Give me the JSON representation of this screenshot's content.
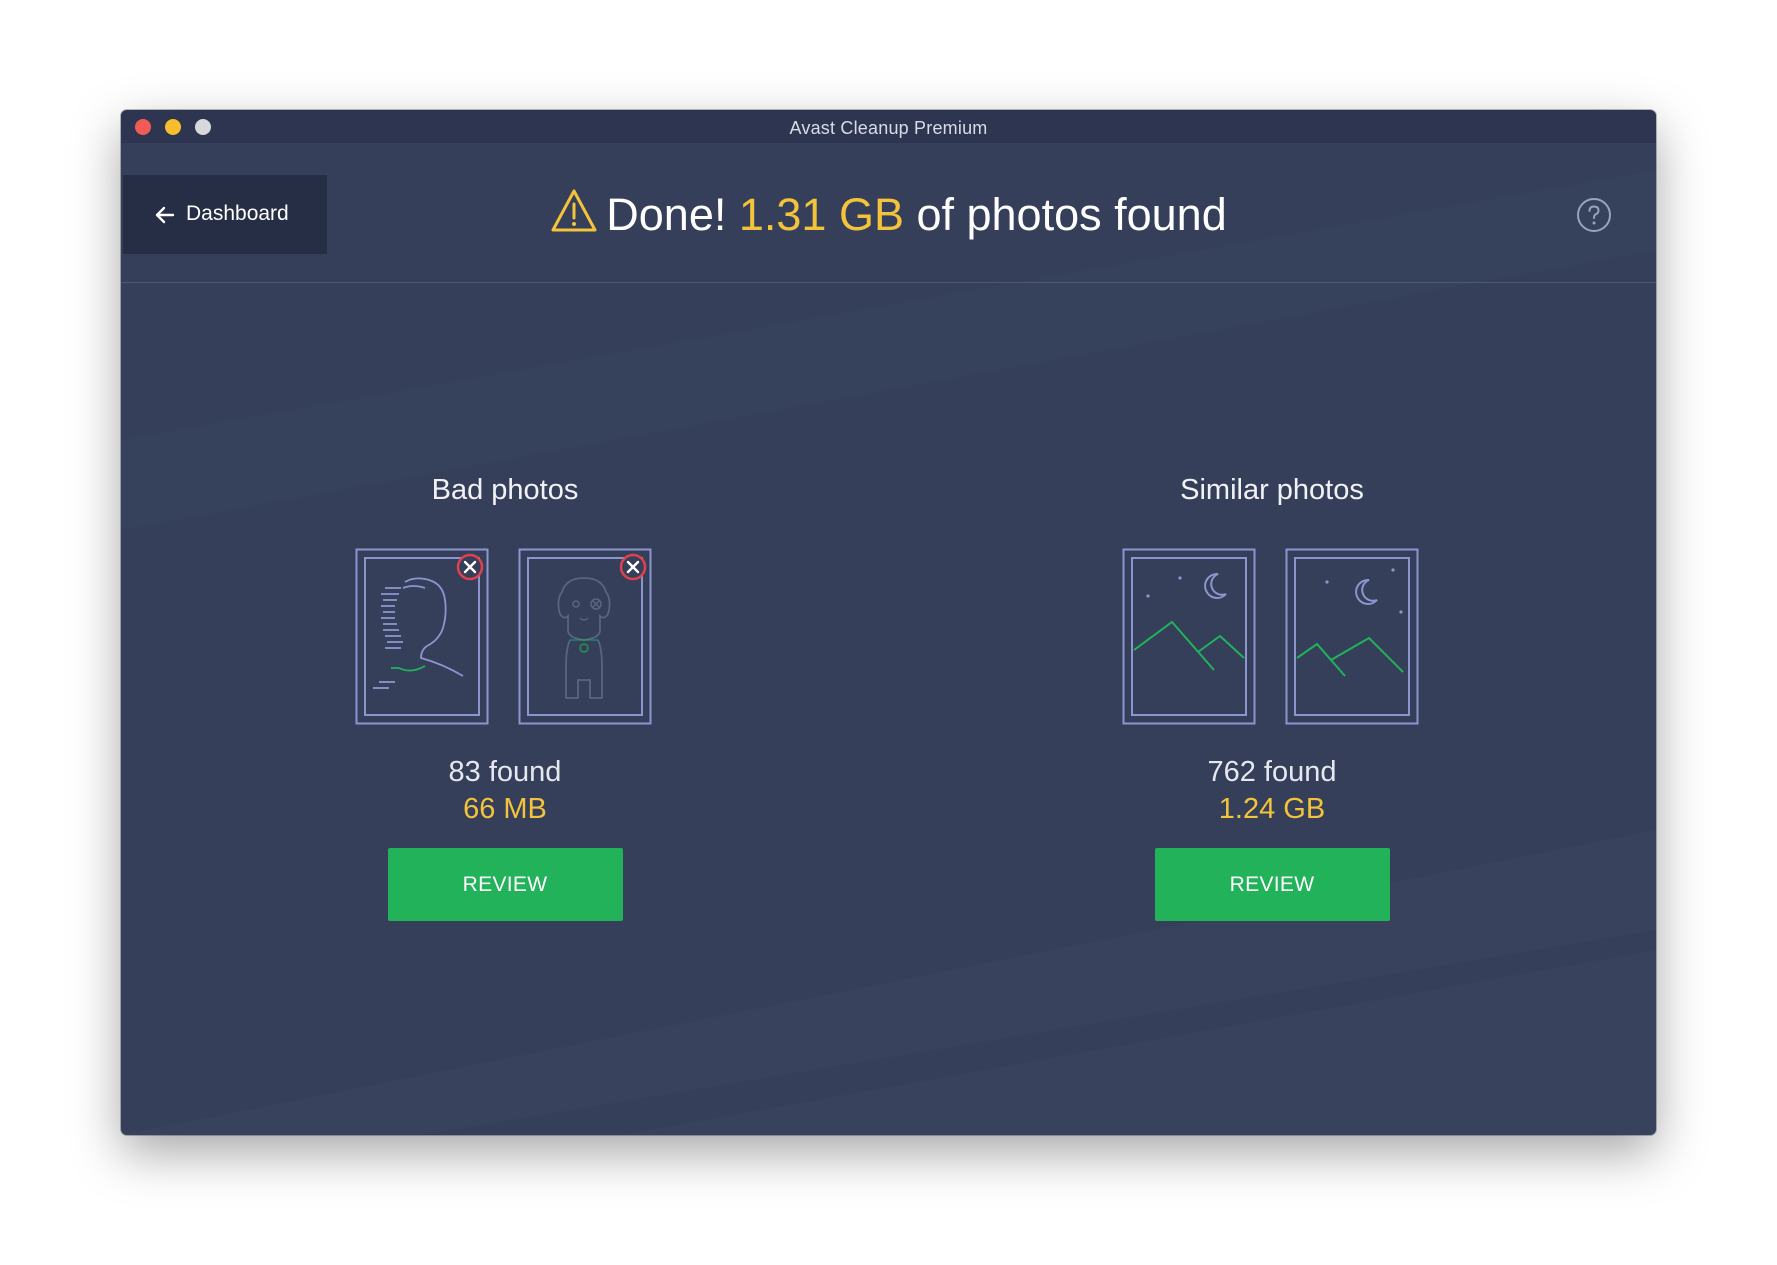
{
  "window": {
    "title": "Avast Cleanup Premium"
  },
  "header": {
    "back_label": "Dashboard",
    "headline_prefix": "Done! ",
    "headline_amount": "1.31 GB",
    "headline_suffix": " of photos found",
    "warning_icon": "warning-triangle-icon",
    "help_icon": "question-circle-icon"
  },
  "sections": [
    {
      "title": "Bad photos",
      "found": "83 found",
      "size": "66 MB",
      "button": "REVIEW"
    },
    {
      "title": "Similar photos",
      "found": "762 found",
      "size": "1.24 GB",
      "button": "REVIEW"
    }
  ],
  "colors": {
    "background": "#353f59",
    "accent_yellow": "#f3c33c",
    "accent_green": "#21b25a",
    "error_red": "#e0414f",
    "frame_lavender": "#8b96cf"
  }
}
